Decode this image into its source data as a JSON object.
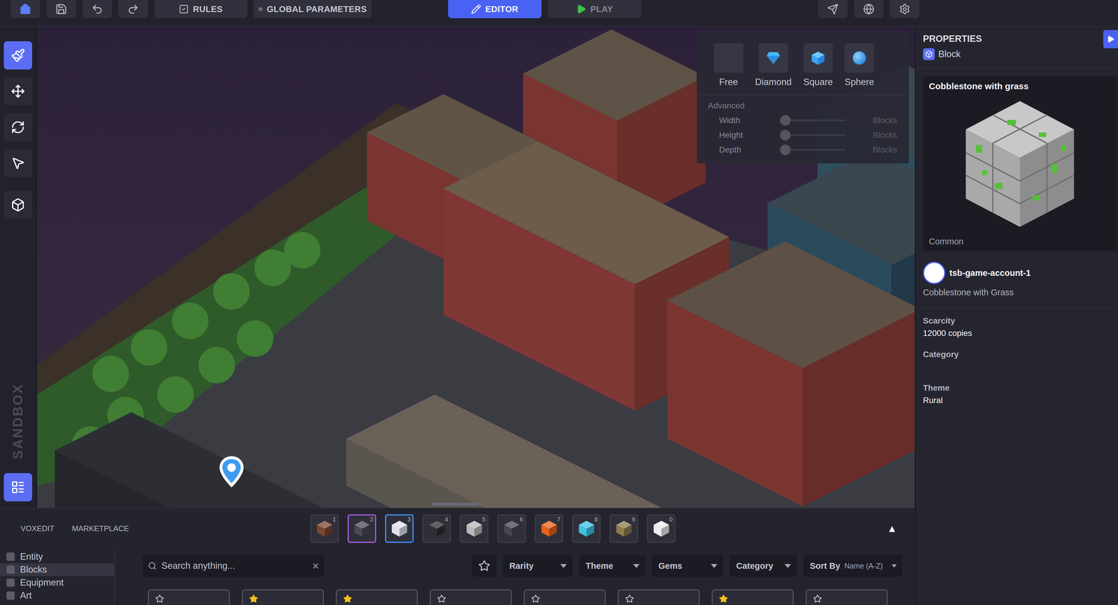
{
  "top_bar": {
    "rules": "RULES",
    "global_parameters": "GLOBAL PARAMETERS",
    "modes": [
      {
        "label": "EDITOR",
        "kind": "edit",
        "selected": true
      },
      {
        "label": "PLAY",
        "kind": "play",
        "selected": false
      }
    ]
  },
  "tools": [
    {
      "kind": "paint",
      "selected": true
    },
    {
      "kind": "move",
      "selected": false
    },
    {
      "kind": "rotate",
      "selected": false
    },
    {
      "kind": "select",
      "selected": false
    },
    {
      "kind": "add-block",
      "selected": false
    }
  ],
  "watermark": "SANDBOX",
  "layers_button": {
    "selected": true
  },
  "shape_panel": {
    "shapes": [
      {
        "label": "Free",
        "kind": "free",
        "selected": false
      },
      {
        "label": "Diamond",
        "kind": "diamond",
        "selected": false
      },
      {
        "label": "Square",
        "kind": "square",
        "selected": false
      },
      {
        "label": "Sphere",
        "kind": "sphere",
        "selected": false
      }
    ],
    "advanced": "Advanced",
    "sliders": [
      {
        "label": "Width",
        "level": 0,
        "unit": "Blocks"
      },
      {
        "label": "Height",
        "level": 0,
        "unit": "Blocks"
      },
      {
        "label": "Depth",
        "level": 0,
        "unit": "Blocks"
      }
    ]
  },
  "properties": {
    "title": "PROPERTIES",
    "type": "Block",
    "asset": {
      "name": "Cobblestone with grass",
      "rarity": "Common"
    },
    "owner": {
      "account": "tsb-game-account-1",
      "item": "Cobblestone with Grass"
    },
    "fields": [
      {
        "label": "Scarcity",
        "value": "12000 copies"
      },
      {
        "label": "Category",
        "value": ""
      },
      {
        "label": "Theme",
        "value": "Rural"
      }
    ]
  },
  "bottom_panel": {
    "tabs": [
      {
        "label": "VOXEDIT",
        "selected": false
      },
      {
        "label": "MARKETPLACE",
        "selected": false
      }
    ],
    "hotbar": [
      {
        "number": "1",
        "color": "#7a4630",
        "selected": false,
        "hovered": false
      },
      {
        "number": "2",
        "color": "#4a4a55",
        "selected": false,
        "hovered": true
      },
      {
        "number": "3",
        "color": "#dfe3ea",
        "selected": true,
        "hovered": false
      },
      {
        "number": "4",
        "color": "#2e2f34",
        "selected": false,
        "hovered": false
      },
      {
        "number": "5",
        "color": "#b9b9b9",
        "selected": false,
        "hovered": false
      },
      {
        "number": "6",
        "color": "#45464e",
        "selected": false,
        "hovered": false
      },
      {
        "number": "7",
        "color": "#e8621a",
        "selected": false,
        "hovered": false
      },
      {
        "number": "8",
        "color": "#3ec3e2",
        "selected": false,
        "hovered": false
      },
      {
        "number": "9",
        "color": "#8c7b4c",
        "selected": false,
        "hovered": false
      },
      {
        "number": "0",
        "color": "#eeeeee",
        "selected": false,
        "hovered": false
      }
    ],
    "expand": "▲",
    "categories": [
      {
        "label": "Entity",
        "selected": false
      },
      {
        "label": "Blocks",
        "selected": true
      },
      {
        "label": "Equipment",
        "selected": false
      },
      {
        "label": "Art",
        "selected": false
      }
    ],
    "search": {
      "placeholder": "Search anything...",
      "clear": "×"
    },
    "favorites_filter": {
      "on": false
    },
    "filters": [
      {
        "label": "Rarity"
      },
      {
        "label": "Theme"
      },
      {
        "label": "Gems"
      },
      {
        "label": "Category"
      }
    ],
    "sort": {
      "label": "Sort By",
      "value": "Name (A-Z)"
    },
    "cards": [
      {
        "favorite": false
      },
      {
        "favorite": true
      },
      {
        "favorite": true
      },
      {
        "favorite": false
      },
      {
        "favorite": false
      },
      {
        "favorite": false
      },
      {
        "favorite": true
      },
      {
        "favorite": false
      }
    ]
  }
}
